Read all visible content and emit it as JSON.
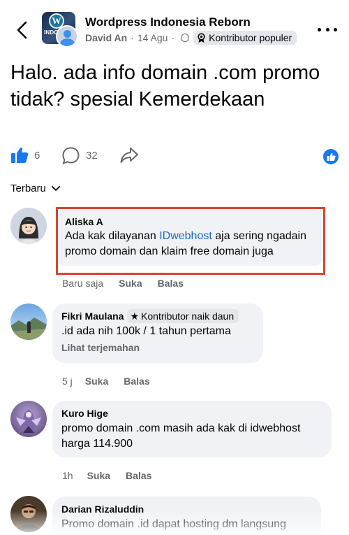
{
  "header": {
    "group_name": "Wordpress Indonesia Reborn",
    "author": "David An",
    "date": "14 Agu",
    "separator": "·",
    "badge": "Kontributor populer",
    "group_thumb_text": "INDONES"
  },
  "post": {
    "title": "Halo. ada info domain .com promo tidak? spesial Kemerdekaan",
    "like_count": "6",
    "comment_count": "32"
  },
  "sort": {
    "label": "Terbaru"
  },
  "comments": [
    {
      "name": "Aliska A",
      "text_before": "Ada kak dilayanan ",
      "link": "IDwebhost",
      "text_after": " aja sering ngadain promo domain dan klaim free domain juga",
      "time": "Baru saja",
      "like": "Suka",
      "reply": "Balas"
    },
    {
      "name": "Fikri Maulana",
      "badge": "Kontributor naik daun",
      "text": ".id ada nih 100k /  1 tahun pertama",
      "translate": "Lihat terjemahan",
      "time": "5 j",
      "like": "Suka",
      "reply": "Balas"
    },
    {
      "name": "Kuro Hige",
      "text": "promo domain .com masih ada kak di idwebhost harga 114.900",
      "time": "1h",
      "like": "Suka",
      "reply": "Balas"
    },
    {
      "name": "Darian Rizaluddin",
      "text": "Promo domain .id dapat hosting dm langsung"
    }
  ],
  "colors": {
    "accent": "#1877f2",
    "highlight": "#d9452c",
    "bubble": "#f0f2f5",
    "muted": "#65676b"
  }
}
